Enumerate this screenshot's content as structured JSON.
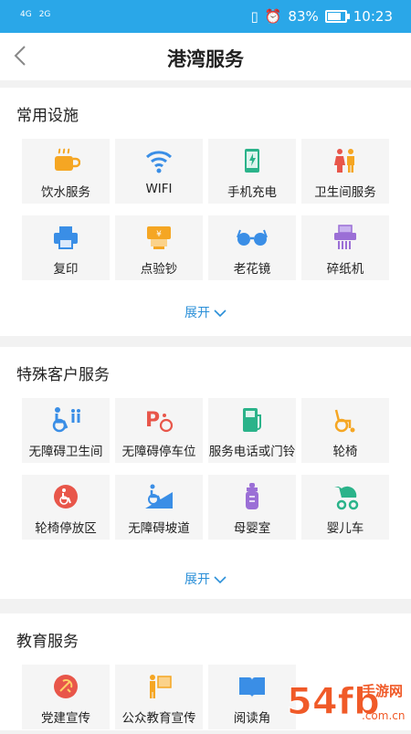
{
  "status": {
    "signal1": "4G",
    "signal2": "2G",
    "battery": "83%",
    "time": "10:23"
  },
  "nav": {
    "title": "港湾服务"
  },
  "sections": [
    {
      "title": "常用设施",
      "items": [
        {
          "label": "饮水服务",
          "icon": "cup-icon"
        },
        {
          "label": "WIFI",
          "icon": "wifi-icon"
        },
        {
          "label": "手机充电",
          "icon": "phone-charge-icon"
        },
        {
          "label": "卫生间服务",
          "icon": "restroom-icon"
        },
        {
          "label": "复印",
          "icon": "printer-icon"
        },
        {
          "label": "点验钞",
          "icon": "cash-check-icon"
        },
        {
          "label": "老花镜",
          "icon": "glasses-icon"
        },
        {
          "label": "碎纸机",
          "icon": "shredder-icon"
        }
      ],
      "expand": "展开"
    },
    {
      "title": "特殊客户服务",
      "items": [
        {
          "label": "无障碍卫生间",
          "icon": "accessible-toilet-icon"
        },
        {
          "label": "无障碍停车位",
          "icon": "accessible-parking-icon"
        },
        {
          "label": "服务电话或门铃",
          "icon": "service-phone-icon"
        },
        {
          "label": "轮椅",
          "icon": "wheelchair-icon"
        },
        {
          "label": "轮椅停放区",
          "icon": "wheelchair-parking-icon"
        },
        {
          "label": "无障碍坡道",
          "icon": "ramp-icon"
        },
        {
          "label": "母婴室",
          "icon": "baby-bottle-icon"
        },
        {
          "label": "婴儿车",
          "icon": "stroller-icon"
        }
      ],
      "expand": "展开"
    },
    {
      "title": "教育服务",
      "items": [
        {
          "label": "党建宣传",
          "icon": "party-icon"
        },
        {
          "label": "公众教育宣传",
          "icon": "education-icon"
        },
        {
          "label": "阅读角",
          "icon": "book-icon"
        }
      ]
    }
  ],
  "watermark": "54fb手游网 www.com.cn",
  "colors": {
    "accent": "#2aa7e8",
    "link": "#2a8fd8",
    "orange": "#f5a623",
    "red": "#e8564a",
    "blue": "#3a8ee6",
    "green": "#2bb38a",
    "purple": "#9b6fd6"
  }
}
